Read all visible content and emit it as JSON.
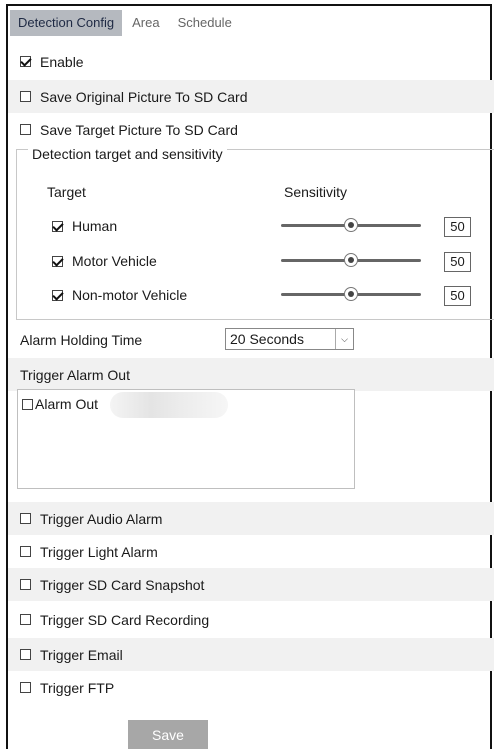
{
  "tabs": [
    "Detection Config",
    "Area",
    "Schedule"
  ],
  "enable": {
    "label": "Enable",
    "checked": true
  },
  "save_original": {
    "label": "Save Original Picture To SD Card",
    "checked": false
  },
  "save_target": {
    "label": "Save Target Picture To SD Card",
    "checked": false
  },
  "detection_group": {
    "title": "Detection target and sensitivity",
    "target_header": "Target",
    "sensitivity_header": "Sensitivity",
    "targets": [
      {
        "label": "Human",
        "checked": true,
        "sensitivity": 50,
        "value": "50"
      },
      {
        "label": "Motor Vehicle",
        "checked": true,
        "sensitivity": 50,
        "value": "50"
      },
      {
        "label": "Non-motor Vehicle",
        "checked": true,
        "sensitivity": 50,
        "value": "50"
      }
    ]
  },
  "alarm_holding_time": {
    "label": "Alarm Holding Time",
    "selected": "20 Seconds"
  },
  "trigger_alarm_out": {
    "label": "Trigger Alarm Out",
    "item_label": "Alarm Out",
    "checked": false
  },
  "triggers": [
    {
      "label": "Trigger Audio Alarm",
      "checked": false
    },
    {
      "label": "Trigger Light Alarm",
      "checked": false
    },
    {
      "label": "Trigger SD Card Snapshot",
      "checked": false
    },
    {
      "label": "Trigger SD Card Recording",
      "checked": false
    },
    {
      "label": "Trigger Email",
      "checked": false
    },
    {
      "label": "Trigger FTP",
      "checked": false
    }
  ],
  "save_label": "Save",
  "colors": {
    "active_tab": "#b5b9bf",
    "row_shade": "#f1f1f1",
    "button": "#a7a7a7"
  }
}
